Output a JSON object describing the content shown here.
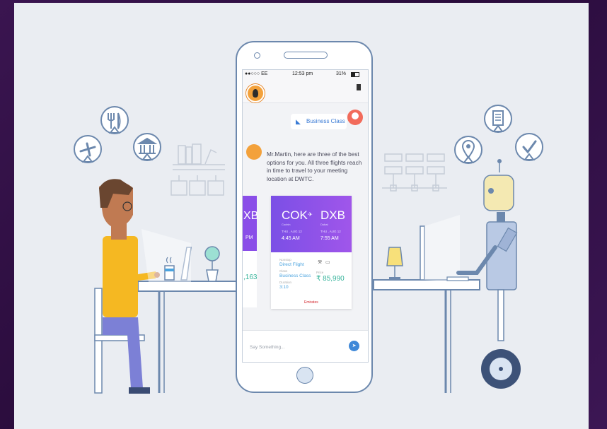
{
  "phone": {
    "status": {
      "carrier": "●●○○○ EE",
      "time": "12:53 pm",
      "battery": "31%"
    },
    "user_message": "Business Class",
    "bot_message": "Mr.Martin, here are three of the best options for you. All three flights reach in time to travel to your meeting location at DWTC.",
    "prev_card": {
      "code_fragment": "XB",
      "time_fragment": "PM",
      "price_fragment": ",163"
    },
    "card": {
      "from_code": "COK",
      "from_city": "Cochin",
      "to_code": "DXB",
      "to_city": "Dubai",
      "depart_date": "THU , AUG 12",
      "depart_time": "4:45 AM",
      "arrive_date": "THU , AUG 12",
      "arrive_time": "7:55 AM",
      "stops_caption": "Nonstop",
      "stops": "Direct Flight",
      "class_caption": "Class",
      "class": "Business Class",
      "duration_caption": "Duration",
      "duration": "3:10",
      "price_caption": "Price",
      "price": "₹ 85,990",
      "airline": "Emirates"
    },
    "input_placeholder": "Say Something..."
  },
  "colors": {
    "background": "#2a0c3c",
    "card": "#eaedf2",
    "accent": "#8a4ee8",
    "price": "#35b39a",
    "outline": "#6c88ad"
  },
  "icons": [
    "airplane-icon",
    "fork-knife-icon",
    "bank-icon",
    "document-icon",
    "location-pin-icon",
    "check-icon",
    "send-icon"
  ]
}
